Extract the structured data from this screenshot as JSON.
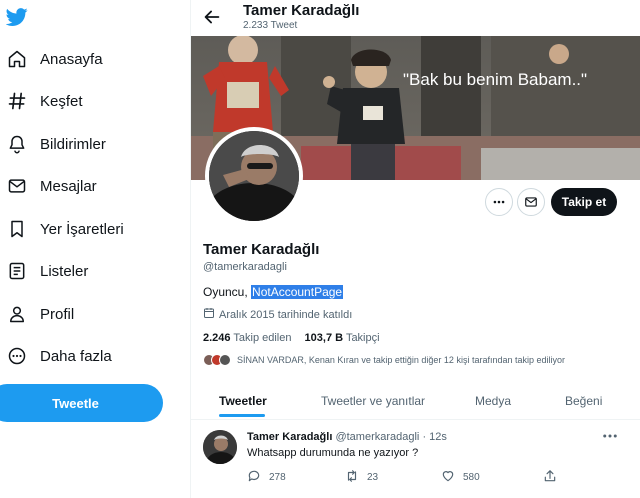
{
  "nav": {
    "logo_icon": "twitter-bird-icon",
    "items": [
      {
        "label": "Anasayfa",
        "icon": "home-icon"
      },
      {
        "label": "Keşfet",
        "icon": "hashtag-icon"
      },
      {
        "label": "Bildirimler",
        "icon": "bell-icon"
      },
      {
        "label": "Mesajlar",
        "icon": "mail-icon"
      },
      {
        "label": "Yer İşaretleri",
        "icon": "bookmark-icon"
      },
      {
        "label": "Listeler",
        "icon": "list-icon"
      },
      {
        "label": "Profil",
        "icon": "person-icon"
      },
      {
        "label": "Daha fazla",
        "icon": "more-circle-icon"
      }
    ],
    "tweet_button": "Tweetle"
  },
  "header": {
    "name": "Tamer Karadağlı",
    "tweet_count": "2.233 Tweet"
  },
  "banner": {
    "caption": "\"Bak bu benim Babam..\""
  },
  "profile": {
    "name": "Tamer Karadağlı",
    "handle": "@tamerkaradagli",
    "bio_text": "Oyuncu, ",
    "bio_highlight": "NotAccountPage",
    "joined": "Aralık 2015 tarihinde katıldı",
    "following_count": "2.246",
    "following_label": "Takip edilen",
    "followers_count": "103,7 B",
    "followers_label": "Takipçi",
    "followed_by": "SİNAN VARDAR, Kenan Kıran ve takip ettiğin diğer 12 kişi tarafından takip ediliyor",
    "follow_button": "Takip et"
  },
  "tabs": [
    {
      "label": "Tweetler",
      "active": true
    },
    {
      "label": "Tweetler ve yanıtlar",
      "active": false
    },
    {
      "label": "Medya",
      "active": false
    },
    {
      "label": "Beğeni",
      "active": false
    }
  ],
  "tweet": {
    "author": "Tamer Karadağlı",
    "handle": "@tamerkaradagli",
    "time": "· 12s",
    "text": "Whatsapp durumunda ne yazıyor ?",
    "replies": "278",
    "retweets": "23",
    "likes": "580"
  },
  "colors": {
    "accent": "#1d9bf0",
    "text": "#0f1419",
    "muted": "#536471",
    "highlight": "#2f7fe8"
  }
}
